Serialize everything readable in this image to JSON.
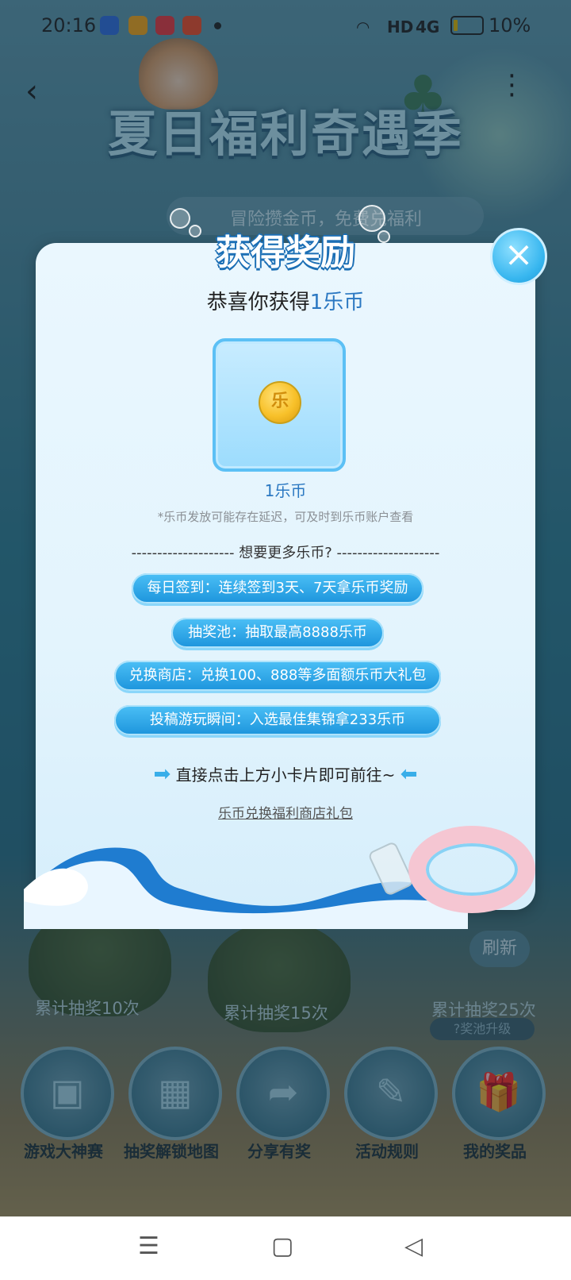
{
  "status_bar": {
    "time": "20:16",
    "network": "HD",
    "signal": "4G",
    "battery": "10%",
    "battery_level": 0.1
  },
  "page": {
    "title": "夏日福利奇遇季",
    "subtitle": "冒险攒金币，免费兑福利",
    "refresh_label": "刷新",
    "help_label": "?奖池升级",
    "islands": [
      {
        "label": "累计抽奖10次"
      },
      {
        "label": "累计抽奖15次"
      },
      {
        "label": "累计抽奖25次"
      }
    ],
    "nav": [
      {
        "label": "游戏大神赛",
        "icon": "gamepad-icon"
      },
      {
        "label": "抽奖解锁地图",
        "icon": "map-icon"
      },
      {
        "label": "分享有奖",
        "icon": "share-icon"
      },
      {
        "label": "活动规则",
        "icon": "notebook-icon"
      },
      {
        "label": "我的奖品",
        "icon": "gift-icon"
      }
    ]
  },
  "modal": {
    "title": "获得奖励",
    "congrats_prefix": "恭喜你获得",
    "congrats_amount": "1乐币",
    "reward_amount": "1乐币",
    "coin_glyph": "乐",
    "note": "*乐币发放可能存在延迟，可及时到乐币账户查看",
    "divider_text": "--------------------  想要更多乐币?  --------------------",
    "options": [
      {
        "label": "每日签到：连续签到3天、7天拿乐币奖励"
      },
      {
        "label": "抽奖池：抽取最高8888乐币"
      },
      {
        "label": "兑换商店：兑换100、888等多面额乐币大礼包"
      },
      {
        "label": "投稿游玩瞬间：入选最佳集锦拿233乐币"
      }
    ],
    "hint": "直接点击上方小卡片即可前往~",
    "link": "乐币兑换福利商店礼包"
  },
  "colors": {
    "accent_blue": "#2b78c2",
    "pill_blue": "#1c94dc",
    "coin_gold": "#f8c12a"
  }
}
